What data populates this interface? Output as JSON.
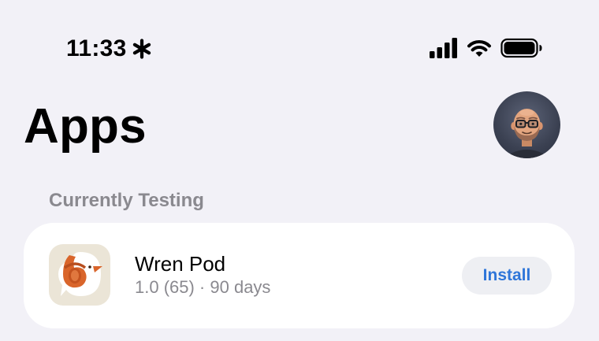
{
  "status_bar": {
    "time": "11:33",
    "icons": [
      "asterisk-icon",
      "signal-icon",
      "wifi-icon",
      "battery-icon"
    ]
  },
  "header": {
    "title": "Apps",
    "avatar": "user-avatar"
  },
  "section": {
    "title": "Currently Testing"
  },
  "apps": [
    {
      "name": "Wren Pod",
      "meta": "1.0 (65) · 90 days",
      "action_label": "Install",
      "icon": "wren-pod-app-icon"
    }
  ],
  "colors": {
    "background": "#f2f1f7",
    "card": "#ffffff",
    "accent": "#2f76d9",
    "secondary_text": "#8a898f",
    "button_bg": "#eeeff3"
  }
}
